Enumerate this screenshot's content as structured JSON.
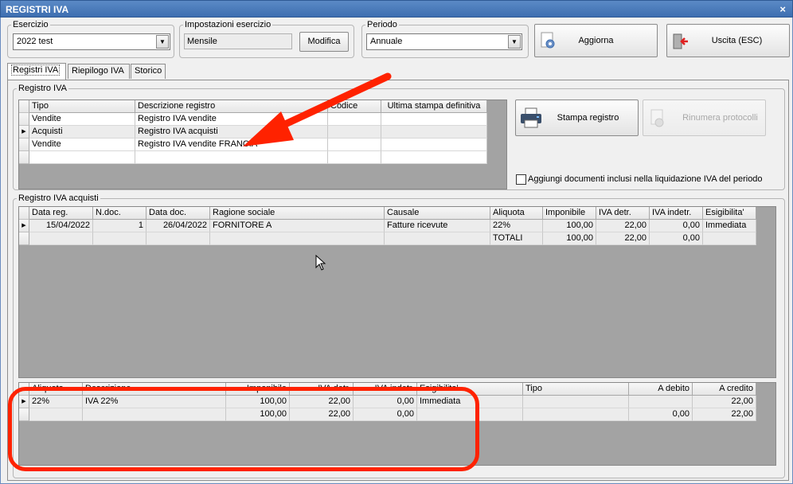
{
  "window": {
    "title": "REGISTRI IVA",
    "close_glyph": "×"
  },
  "esercizio": {
    "legend": "Esercizio",
    "value": "2022 test"
  },
  "impostazioni": {
    "legend": "Impostazioni esercizio",
    "value": "Mensile",
    "modify_label": "Modifica"
  },
  "periodo": {
    "legend": "Periodo",
    "value": "Annuale"
  },
  "toolbar": {
    "refresh_label": "Aggiorna",
    "exit_label": "Uscita (ESC)"
  },
  "tabs": [
    {
      "label": "Registri IVA"
    },
    {
      "label": "Riepilogo IVA"
    },
    {
      "label": "Storico"
    }
  ],
  "registri": {
    "legend": "Registro IVA",
    "columns": [
      "Tipo",
      "Descrizione registro",
      "Codice",
      "Ultima stampa definitiva"
    ],
    "rows": [
      {
        "tipo": "Vendite",
        "descrizione": "Registro IVA vendite",
        "codice": "",
        "ultima": ""
      },
      {
        "tipo": "Acquisti",
        "descrizione": "Registro IVA acquisti",
        "codice": "",
        "ultima": ""
      },
      {
        "tipo": "Vendite",
        "descrizione": "Registro IVA vendite FRANCIA",
        "codice": "",
        "ultima": ""
      }
    ],
    "print_label": "Stampa registro",
    "renumber_label": "Rinumera protocolli",
    "include_docs_label": "Aggiungi documenti inclusi nella liquidazione IVA del periodo"
  },
  "acquisti": {
    "legend": "Registro IVA acquisti",
    "columns": [
      "Data reg.",
      "N.doc.",
      "Data doc.",
      "Ragione sociale",
      "Causale",
      "Aliquota",
      "Imponibile",
      "IVA detr.",
      "IVA indetr.",
      "Esigibilita'"
    ],
    "rows": [
      {
        "data_reg": "15/04/2022",
        "ndoc": "1",
        "data_doc": "26/04/2022",
        "ragione": "FORNITORE A",
        "causale": "Fatture ricevute",
        "aliquota": "22%",
        "imponibile": "100,00",
        "iva_detr": "22,00",
        "iva_indetr": "0,00",
        "esig": "Immediata"
      },
      {
        "data_reg": "",
        "ndoc": "",
        "data_doc": "",
        "ragione": "",
        "causale": "",
        "aliquota": "TOTALI",
        "imponibile": "100,00",
        "iva_detr": "22,00",
        "iva_indetr": "0,00",
        "esig": ""
      }
    ]
  },
  "riepilogo": {
    "columns": [
      "Aliquota",
      "Descrizione",
      "Imponibile",
      "IVA detr.",
      "IVA indetr.",
      "Esigibilita'",
      "Tipo",
      "A debito",
      "A credito"
    ],
    "rows": [
      {
        "aliquota": "22%",
        "descrizione": "IVA 22%",
        "imponibile": "100,00",
        "iva_detr": "22,00",
        "iva_indetr": "0,00",
        "esig": "Immediata",
        "tipo": "",
        "debito": "",
        "credito": "22,00"
      },
      {
        "aliquota": "",
        "descrizione": "",
        "imponibile": "100,00",
        "iva_detr": "22,00",
        "iva_indetr": "0,00",
        "esig": "",
        "tipo": "",
        "debito": "0,00",
        "credito": "22,00"
      }
    ]
  },
  "colors": {
    "title_bar": "#3d6eb0",
    "grid_background": "#a3a3a3",
    "annotation_red": "#ff2200"
  },
  "icons": {
    "printer": "printer-icon",
    "refresh": "refresh-gear-icon",
    "exit": "exit-door-icon",
    "renumber": "renumber-icon",
    "row_indicator": "▶"
  }
}
